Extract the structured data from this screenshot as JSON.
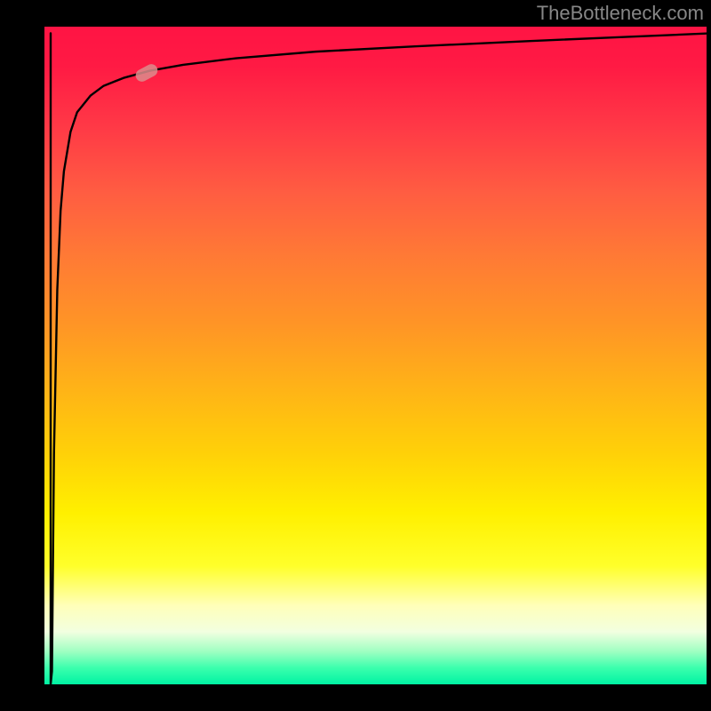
{
  "watermark": "TheBottleneck.com",
  "chart_data": {
    "type": "line",
    "title": "",
    "xlabel": "",
    "ylabel": "",
    "x_range": [
      0,
      100
    ],
    "y_range": [
      0,
      100
    ],
    "series": [
      {
        "name": "curve",
        "x": [
          0.0,
          0.2,
          0.5,
          1.0,
          1.5,
          2.0,
          3.0,
          4.0,
          6.0,
          8.0,
          11.0,
          15.0,
          20.0,
          28.0,
          40.0,
          55.0,
          72.0,
          86.0,
          100.0
        ],
        "y": [
          0.0,
          2.0,
          35.0,
          60.0,
          72.0,
          78.0,
          84.0,
          87.0,
          89.5,
          91.0,
          92.2,
          93.3,
          94.2,
          95.2,
          96.2,
          97.0,
          97.8,
          98.4,
          99.0
        ]
      }
    ],
    "marker": {
      "x": 14.5,
      "y": 93.0
    },
    "background_gradient": {
      "top": "#ff1444",
      "mid": "#fff000",
      "bottom": "#00f3a3"
    }
  }
}
